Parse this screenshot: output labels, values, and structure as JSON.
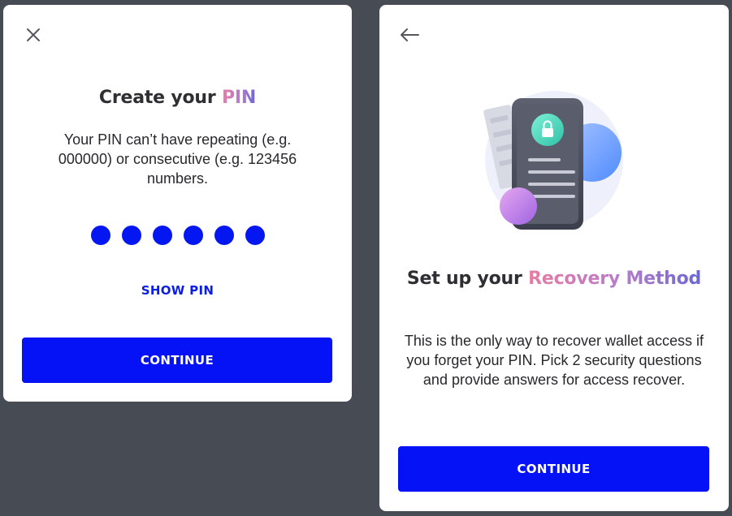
{
  "pin_screen": {
    "close_icon": "close-icon",
    "title_prefix": "Create your",
    "title_highlight": "PIN",
    "description": "Your PIN can’t have repeating (e.g. 000000) or consecutive (e.g. 123456 numbers.",
    "pin_length": 6,
    "show_pin_label": "SHOW PIN",
    "continue_label": "CONTINUE"
  },
  "recovery_screen": {
    "back_icon": "arrow-left-icon",
    "illustration": "phone-lock-illustration",
    "title_prefix": "Set up your",
    "title_highlight": "Recovery Method",
    "description": "This is the only way to recover wallet access if you forget your PIN. Pick 2 security questions and provide answers for access recover.",
    "continue_label": "CONTINUE"
  },
  "colors": {
    "background": "#474b53",
    "primary_button": "#0512f5",
    "pin_dot": "#0517f0",
    "show_pin_text": "#0a1ee8",
    "gradient_start": "#e77da3",
    "gradient_end": "#6b66d6"
  }
}
